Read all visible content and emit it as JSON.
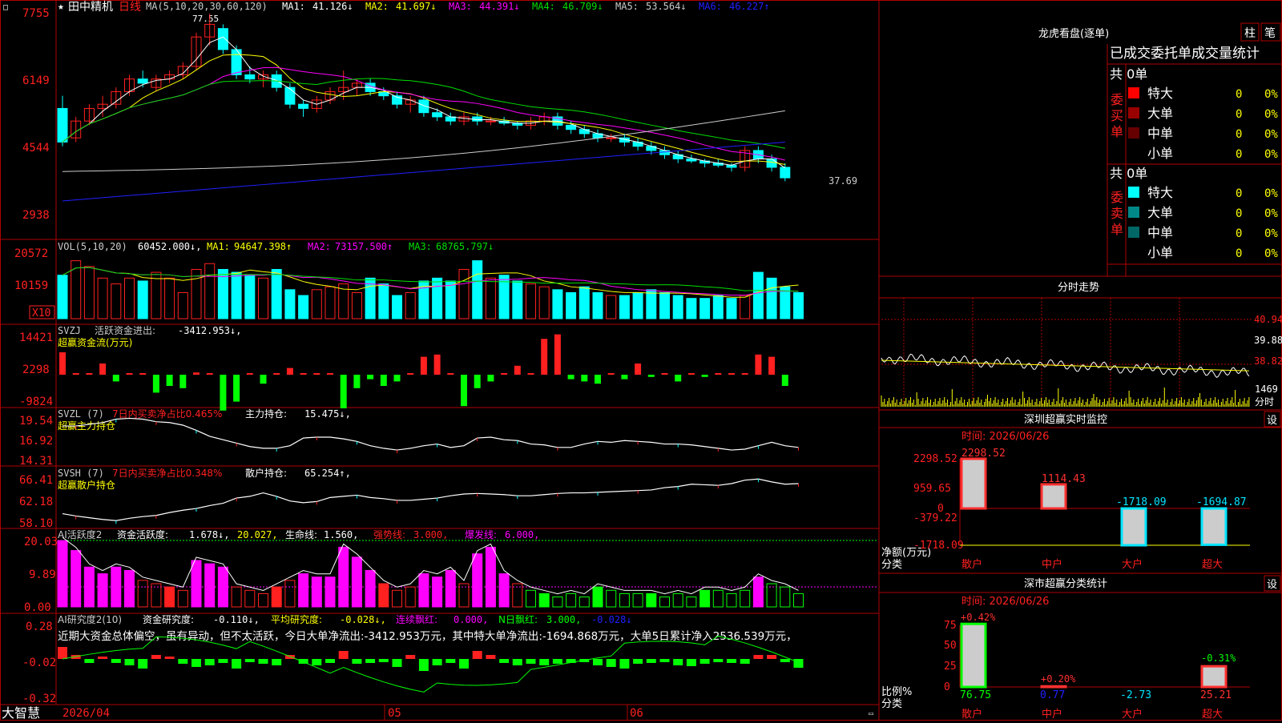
{
  "colors": {
    "bg": "#000000",
    "frame": "#b00000",
    "up": "#ff2020",
    "down": "#00ffff",
    "ma1": "#ffffff",
    "ma2": "#ffff00",
    "ma3": "#ff00ff",
    "ma4": "#00dd00",
    "ma5": "#cccccc",
    "ma6": "#2020ff",
    "green": "#00ff00",
    "magenta": "#ff00ff",
    "yellow": "#ffff00"
  },
  "main": {
    "title_star": "★",
    "title": "田中精机",
    "period": "日线",
    "ma_label": "MA(5,10,20,30,60,120)",
    "ma_values": [
      {
        "name": "MA1:",
        "value": "41.126↓",
        "color": "#ffffff"
      },
      {
        "name": "MA2:",
        "value": "41.697↓",
        "color": "#ffff00"
      },
      {
        "name": "MA3:",
        "value": "44.391↓",
        "color": "#ff00ff"
      },
      {
        "name": "MA4:",
        "value": "46.709↓",
        "color": "#00dd00"
      },
      {
        "name": "MA5:",
        "value": "53.564↓",
        "color": "#cccccc"
      },
      {
        "name": "MA6:",
        "value": "46.227↑",
        "color": "#2020ff"
      }
    ],
    "axis_labels": [
      "7755",
      "6149",
      "4544",
      "2938"
    ],
    "high_label": "77.55",
    "low_label": "37.69"
  },
  "vol": {
    "label": "VOL(5,10,20)",
    "value": "60452.000↓,",
    "ma": [
      {
        "name": "MA1:",
        "value": "94647.398↑",
        "color": "#ffff00"
      },
      {
        "name": "MA2:",
        "value": "73157.500↑",
        "color": "#ff00ff"
      },
      {
        "name": "MA3:",
        "value": "68765.797↓",
        "color": "#00dd00"
      }
    ],
    "axis_labels": [
      "20572",
      "10159"
    ],
    "unit_badge": "X10"
  },
  "svzj": {
    "label": "SVZJ",
    "desc": "活跃资金进出:",
    "value": "-3412.953↓,",
    "sub": "超赢资金流(万元)",
    "axis_labels": [
      "14421",
      "2298",
      "-9824"
    ]
  },
  "svzl": {
    "label": "SVZL (7)",
    "red_text": "7日内买卖净占比0.465%",
    "text": "主力持仓:",
    "value": "15.475↓,",
    "sub": "超赢主力持仓",
    "axis_labels": [
      "19.54",
      "16.92",
      "14.31"
    ]
  },
  "svsh": {
    "label": "SVSH (7)",
    "red_text": "7日内买卖净占比0.348%",
    "text": "散户持仓:",
    "value": "65.254↑,",
    "sub": "超赢散户持仓",
    "axis_labels": [
      "66.41",
      "62.18",
      "58.10"
    ]
  },
  "ai1": {
    "label": "AI活跃度2",
    "t1": "资金活跃度:",
    "v1": "1.678↓,",
    "v2": "20.027,",
    "t3": "生命线:",
    "v3": "1.560,",
    "t4": "强势线:",
    "v4": "3.000,",
    "t5": "爆发线:",
    "v5": "6.000,",
    "axis_labels": [
      "20.03",
      "9.89",
      "0.00"
    ]
  },
  "ai2": {
    "label": "AI研究度2(10)",
    "t1": "资金研究度:",
    "v1": "-0.110↓,",
    "t2": "平均研究度:",
    "v2": "-0.028↓,",
    "t3": "连续飘红:",
    "v3": "0.000,",
    "t4": "N日飘红:",
    "v4": "3.000,",
    "v5": "-0.028↓",
    "comment": "近期大资金总体偏空，虽有异动，但不太活跃，今日大单净流出:-3412.953万元，其中特大单净流出:-1694.868万元，大单5日累计净入2536.539万元，",
    "axis_labels": [
      "0.28",
      "-0.02",
      "-0.32"
    ]
  },
  "bottom": {
    "brand": "大智慧",
    "dates": [
      "2026/04",
      "05",
      "06"
    ]
  },
  "right": {
    "lhb_title": "龙虎看盘(逐单)",
    "btn_bar": "柱",
    "btn_tick": "笔",
    "stat_title": "已成交委托单成交量统计",
    "buy_label": "委买单",
    "sell_label": "委卖单",
    "buy_total": "共 0单",
    "sell_total": "共 0单",
    "buy_rows": [
      {
        "name": "特大",
        "count": "0",
        "pct": "0%",
        "color": "#ff0000"
      },
      {
        "name": "大单",
        "count": "0",
        "pct": "0%",
        "color": "#990000"
      },
      {
        "name": "中单",
        "count": "0",
        "pct": "0%",
        "color": "#660000"
      },
      {
        "name": "小单",
        "count": "0",
        "pct": "0%",
        "color": "#000000"
      }
    ],
    "sell_rows": [
      {
        "name": "特大",
        "count": "0",
        "pct": "0%",
        "color": "#00ffff"
      },
      {
        "name": "大单",
        "count": "0",
        "pct": "0%",
        "color": "#008888"
      },
      {
        "name": "中单",
        "count": "0",
        "pct": "0%",
        "color": "#006666"
      },
      {
        "name": "小单",
        "count": "0",
        "pct": "0%",
        "color": "#000000"
      }
    ],
    "fs_title": "分时走势",
    "fs_axis": [
      "40.94",
      "39.88",
      "38.82"
    ],
    "fs_vol": "1469",
    "fs_unit": "分时",
    "monitor_title": "深圳超赢实时监控",
    "monitor_btn": "设",
    "monitor_time": "时间: 2026/06/26",
    "monitor_axis": [
      "2298.52",
      "959.65",
      "0",
      "-379.22",
      "-1718.09"
    ],
    "monitor_ylabel": "净额(万元)",
    "monitor_xlabel": "分类",
    "class_title": "深市超赢分类统计",
    "class_btn": "设",
    "class_time": "时间: 2026/06/26",
    "class_axis": [
      "75",
      "50",
      "25",
      "0"
    ],
    "class_ylabel": "比例%",
    "class_xlabel": "分类"
  },
  "chart_data": [
    {
      "type": "bar",
      "title": "深圳超赢实时监控",
      "categories": [
        "散户",
        "中户",
        "大户",
        "超大"
      ],
      "values": [
        2298.52,
        1114.43,
        -1718.09,
        -1694.87
      ],
      "ylabel": "净额(万元)",
      "xlabel": "分类",
      "ylim": [
        -1718.09,
        2298.52
      ]
    },
    {
      "type": "bar",
      "title": "深市超赢分类统计",
      "categories": [
        "散户",
        "中户",
        "大户",
        "超大"
      ],
      "values": [
        76.75,
        0.77,
        -2.73,
        25.21
      ],
      "changes": [
        "+0.42%",
        "+0.20%",
        "",
        "-0.31%"
      ],
      "ylabel": "比例%",
      "xlabel": "分类",
      "ylim": [
        0,
        75
      ]
    },
    {
      "type": "candlestick",
      "title": "田中精机 日线",
      "ylim": [
        29.38,
        77.55
      ],
      "high": 77.55,
      "low": 37.69,
      "ohlc": [
        [
          55,
          58,
          46,
          47
        ],
        [
          48,
          53,
          47,
          52
        ],
        [
          52,
          56,
          51,
          55
        ],
        [
          55,
          58,
          53,
          56
        ],
        [
          56,
          60,
          55,
          59
        ],
        [
          59,
          63,
          58,
          62
        ],
        [
          62,
          64,
          60,
          61
        ],
        [
          60,
          63,
          59,
          62
        ],
        [
          62,
          64,
          61,
          63
        ],
        [
          63,
          66,
          62,
          65
        ],
        [
          65,
          73,
          64,
          72
        ],
        [
          72,
          77.55,
          70,
          75
        ],
        [
          74,
          75,
          68,
          69
        ],
        [
          69,
          70,
          62,
          63
        ],
        [
          63,
          65,
          61,
          62
        ],
        [
          62,
          64,
          60,
          63
        ],
        [
          63,
          64,
          59,
          60
        ],
        [
          60,
          61,
          55,
          56
        ],
        [
          56,
          57,
          53,
          55
        ],
        [
          55,
          58,
          54,
          57
        ],
        [
          57,
          60,
          56,
          59
        ],
        [
          59,
          64,
          57,
          60
        ],
        [
          60,
          62,
          58,
          61
        ],
        [
          61,
          62,
          58,
          59
        ],
        [
          59,
          60,
          57,
          58
        ],
        [
          58,
          59,
          55,
          56
        ],
        [
          56,
          58,
          54,
          57
        ],
        [
          57,
          58,
          53,
          54
        ],
        [
          54,
          55,
          52,
          53
        ],
        [
          53,
          54,
          51,
          52
        ],
        [
          52,
          54,
          51,
          53
        ],
        [
          53,
          54,
          51,
          52
        ],
        [
          52,
          53,
          51,
          52
        ],
        [
          52,
          53,
          51,
          51.5
        ],
        [
          51.5,
          52,
          50,
          51
        ],
        [
          51,
          53,
          50,
          52
        ],
        [
          52,
          54,
          51,
          53
        ],
        [
          53,
          54,
          50,
          51
        ],
        [
          51,
          52,
          49,
          50
        ],
        [
          50,
          51,
          48,
          49
        ],
        [
          49,
          50,
          47,
          48
        ],
        [
          48,
          49,
          47,
          48
        ],
        [
          48,
          49,
          46,
          47
        ],
        [
          47,
          48,
          45,
          46
        ],
        [
          46,
          47,
          44,
          45
        ],
        [
          45,
          46,
          43,
          44
        ],
        [
          44,
          45,
          42,
          43
        ],
        [
          43,
          44,
          42,
          42.5
        ],
        [
          42.5,
          43,
          41,
          42
        ],
        [
          42,
          43,
          41,
          41.5
        ],
        [
          41.5,
          42,
          40,
          41
        ],
        [
          41,
          46,
          40,
          45
        ],
        [
          45,
          46,
          42,
          43
        ],
        [
          43,
          44,
          40,
          41
        ],
        [
          41,
          42,
          37.69,
          38.5
        ]
      ]
    },
    {
      "type": "bar",
      "title": "VOL(5,10,20)",
      "values": [
        15,
        20,
        18,
        14,
        12,
        14,
        13,
        16,
        14,
        9,
        17,
        19,
        17,
        16,
        15,
        14,
        17,
        10,
        8,
        10,
        11,
        12,
        9,
        14,
        12,
        8,
        9,
        13,
        14,
        13,
        17,
        20,
        14,
        15,
        13,
        12,
        11,
        10,
        9,
        11,
        9,
        8,
        8,
        9,
        10,
        9,
        8,
        7,
        7,
        8,
        7,
        8,
        16,
        14,
        11,
        9
      ]
    },
    {
      "type": "bar",
      "title": "SVZJ",
      "values": [
        1,
        0,
        0,
        0.5,
        -0.3,
        0,
        0,
        -0.8,
        -0.5,
        -0.6,
        0.1,
        0,
        -1.6,
        -1.2,
        0,
        -0.4,
        0,
        0.3,
        0,
        0,
        0,
        -1.5,
        -0.6,
        -0.2,
        -0.5,
        -0.3,
        0,
        0.8,
        0.9,
        0,
        -1.4,
        -0.6,
        -0.3,
        0,
        0.4,
        0,
        1.6,
        1.8,
        -0.2,
        -0.3,
        -0.4,
        0,
        -0.2,
        0.5,
        -0.1,
        0,
        -0.3,
        0,
        -0.1,
        0,
        0,
        0,
        0.9,
        0.8,
        -0.5
      ]
    },
    {
      "type": "line",
      "title": "SVZL",
      "values": [
        18.6,
        18.6,
        18.8,
        19.0,
        19.4,
        19.5,
        19.4,
        19.1,
        19.0,
        18.7,
        18.1,
        17.4,
        17.0,
        16.6,
        16.2,
        16.0,
        16.0,
        16.3,
        17.2,
        17.3,
        17.3,
        17.1,
        16.8,
        16.3,
        16.0,
        15.8,
        16.0,
        16.3,
        16.5,
        16.1,
        16.3,
        17.2,
        17.3,
        17.0,
        16.9,
        16.5,
        16.4,
        16.1,
        16.1,
        16.5,
        16.8,
        16.7,
        16.9,
        16.8,
        16.7,
        16.5,
        16.5,
        16.4,
        16.2,
        16.0,
        15.8,
        15.9,
        16.3,
        16.7,
        16.3,
        16.1
      ]
    },
    {
      "type": "line",
      "title": "SVSH",
      "values": [
        60.1,
        59.7,
        59.4,
        59.1,
        58.9,
        59.3,
        59.6,
        59.8,
        60.3,
        60.7,
        61.0,
        61.5,
        61.9,
        62.8,
        63.1,
        63.7,
        63.1,
        62.3,
        62.0,
        62.2,
        62.9,
        63.1,
        63.3,
        62.9,
        62.7,
        62.4,
        62.4,
        62.6,
        62.8,
        63.2,
        63.5,
        63.6,
        63.5,
        63.4,
        63.2,
        63.2,
        63.4,
        63.6,
        63.7,
        63.7,
        63.8,
        63.9,
        64.0,
        64.1,
        64.2,
        64.6,
        64.8,
        65.2,
        65.1,
        65.0,
        65.3,
        65.9,
        66.1,
        65.6,
        65.2,
        65.3
      ]
    },
    {
      "type": "bar",
      "title": "AI活跃度2",
      "values": [
        20,
        17,
        12,
        10,
        12,
        11,
        8,
        7,
        6,
        5,
        14,
        13,
        12,
        6,
        5,
        4,
        6,
        8,
        10,
        9,
        9,
        18,
        15,
        11,
        7,
        5,
        6,
        10,
        9,
        11,
        7,
        16,
        18,
        10,
        7,
        5,
        4,
        3,
        4,
        3,
        6,
        5,
        4,
        4,
        4,
        3,
        4,
        3,
        5,
        5,
        4,
        5,
        9,
        7,
        6,
        4
      ]
    },
    {
      "type": "bar",
      "title": "AI研究度2(10)",
      "values": [
        0.15,
        0.05,
        -0.05,
        0.02,
        -0.05,
        -0.08,
        -0.12,
        0.05,
        0.03,
        -0.06,
        -0.1,
        -0.08,
        -0.05,
        -0.12,
        -0.04,
        -0.06,
        -0.08,
        0.05,
        -0.06,
        -0.08,
        -0.05,
        0.1,
        -0.06,
        -0.05,
        -0.04,
        -0.1,
        0.05,
        -0.15,
        -0.08,
        -0.05,
        -0.12,
        0.1,
        0.05,
        -0.05,
        -0.08,
        -0.06,
        -0.08,
        -0.06,
        -0.05,
        -0.04,
        -0.08,
        -0.1,
        -0.12,
        -0.06,
        -0.05,
        -0.04,
        -0.08,
        -0.09,
        -0.06,
        -0.04,
        -0.05,
        -0.06,
        0.05,
        0.05,
        -0.04,
        -0.11
      ]
    }
  ]
}
